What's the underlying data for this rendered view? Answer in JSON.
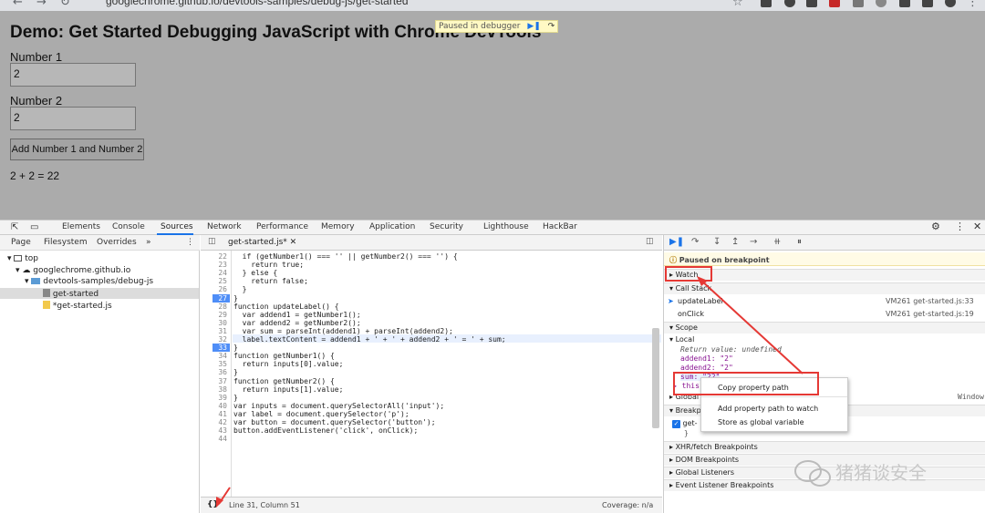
{
  "browser": {
    "url": "googlechrome.github.io/devtools-samples/debug-js/get-started"
  },
  "page": {
    "title": "Demo: Get Started Debugging JavaScript with Chrome DevTools",
    "number1_label": "Number 1",
    "number1_value": "2",
    "number2_label": "Number 2",
    "number2_value": "2",
    "button_label": "Add Number 1 and Number 2",
    "result": "2 + 2 = 22",
    "paused_banner": "Paused in debugger"
  },
  "devtools": {
    "tabs": [
      "Elements",
      "Console",
      "Sources",
      "Network",
      "Performance",
      "Memory",
      "Application",
      "Security",
      "Lighthouse",
      "HackBar"
    ],
    "active_tab": "Sources",
    "navigator": {
      "tabs": [
        "Page",
        "Filesystem",
        "Overrides",
        "»"
      ],
      "tree": [
        "top",
        "googlechrome.github.io",
        "devtools-samples/debug-js",
        "get-started",
        "*get-started.js"
      ]
    },
    "editor": {
      "file_tab": "get-started.js*",
      "status_pos": "Line 31, Column 51",
      "status_coverage": "Coverage: n/a",
      "format_btn": "{}",
      "lines": [
        {
          "n": "22",
          "code": "  if (getNumber1() === '' || getNumber2() === '') {"
        },
        {
          "n": "23",
          "code": "    return true;"
        },
        {
          "n": "24",
          "code": "  } else {"
        },
        {
          "n": "25",
          "code": "    return false;"
        },
        {
          "n": "26",
          "code": "  }"
        },
        {
          "n": "27",
          "code": "}"
        },
        {
          "n": "28",
          "code": "function updateLabel() {"
        },
        {
          "n": "29",
          "code": "  var addend1 = getNumber1();"
        },
        {
          "n": "30",
          "code": "  var addend2 = getNumber2();"
        },
        {
          "n": "31",
          "code": "  var sum = parseInt(addend1) + parseInt(addend2);"
        },
        {
          "n": "32",
          "code": "  label.textContent = addend1 + ' + ' + addend2 + ' = ' + sum;"
        },
        {
          "n": "33",
          "code": "}"
        },
        {
          "n": "34",
          "code": "function getNumber1() {"
        },
        {
          "n": "35",
          "code": "  return inputs[0].value;"
        },
        {
          "n": "36",
          "code": "}"
        },
        {
          "n": "37",
          "code": "function getNumber2() {"
        },
        {
          "n": "38",
          "code": "  return inputs[1].value;"
        },
        {
          "n": "39",
          "code": "}"
        },
        {
          "n": "40",
          "code": "var inputs = document.querySelectorAll('input');"
        },
        {
          "n": "41",
          "code": "var label = document.querySelector('p');"
        },
        {
          "n": "42",
          "code": "var button = document.querySelector('button');"
        },
        {
          "n": "43",
          "code": "button.addEventListener('click', onClick);"
        },
        {
          "n": "44",
          "code": ""
        }
      ]
    },
    "debugger": {
      "paused": "Paused on breakpoint",
      "watch": "Watch",
      "call_stack": "Call Stack",
      "frames": [
        {
          "name": "updateLabel",
          "loc": "VM261 get-started.js:33"
        },
        {
          "name": "onClick",
          "loc": "VM261 get-started.js:19"
        }
      ],
      "scope": "Scope",
      "local": "Local",
      "scope_vars": [
        "Return value: undefined",
        "addend1: \"2\"",
        "addend2: \"2\"",
        "sum: \"22\"",
        "this"
      ],
      "global": "Global",
      "global_value": "Window",
      "breakpoints": "Breakpoints",
      "bp_item": "get-",
      "bp_close": "}",
      "sections": [
        "XHR/fetch Breakpoints",
        "DOM Breakpoints",
        "Global Listeners",
        "Event Listener Breakpoints"
      ]
    },
    "context_menu": [
      "Copy property path",
      "Add property path to watch",
      "Store as global variable"
    ]
  },
  "watermark": "猪猪谈安全"
}
